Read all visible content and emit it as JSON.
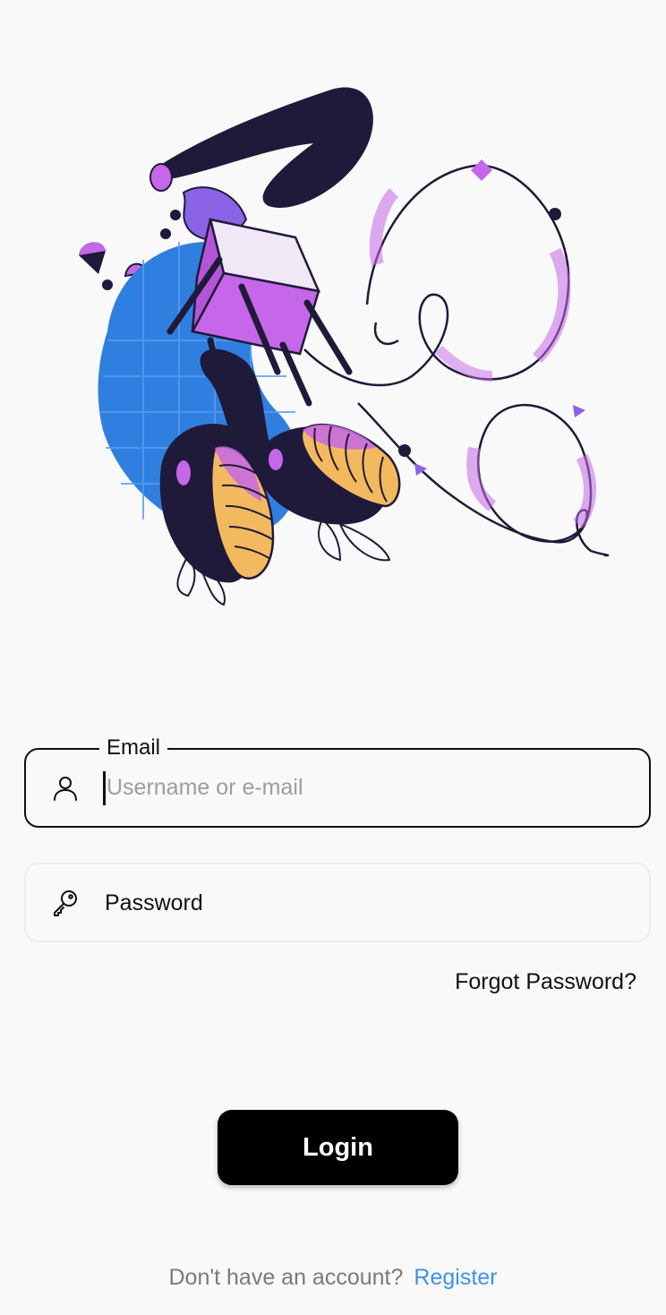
{
  "illustration": {
    "description_name": "abstract-hero-illustration",
    "colors": {
      "dark": "#1f1a3a",
      "purple": "#c567e8",
      "violet": "#8a63e6",
      "blue": "#2f7fe0",
      "orange": "#f3b95f"
    }
  },
  "email_field": {
    "label": "Email",
    "placeholder": "Username or e-mail",
    "value": "",
    "icon": "user-icon"
  },
  "password_field": {
    "label": "Password",
    "icon": "key-icon"
  },
  "forgot_password": "Forgot Password?",
  "login_button": "Login",
  "footer": {
    "text": "Don't have an account?",
    "link": "Register"
  },
  "colors": {
    "background": "#f9f9f9",
    "primary": "#000000",
    "link": "#3d93e6",
    "muted": "#7a7a7a"
  }
}
